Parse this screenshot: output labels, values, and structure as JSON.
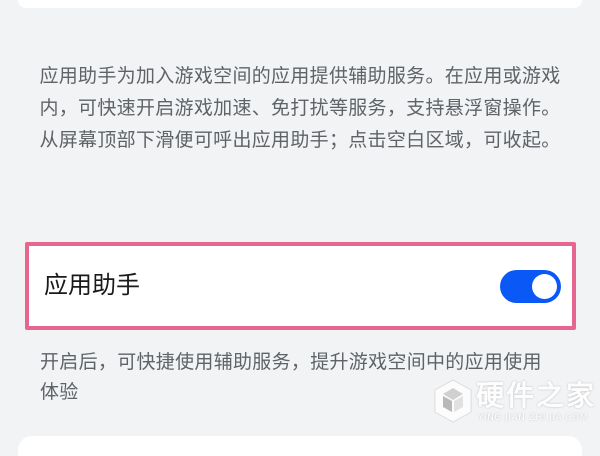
{
  "assistant_section": {
    "description": "应用助手为加入游戏空间的应用提供辅助服务。在应用或游戏内，可快速开启游戏加速、免打扰等服务，支持悬浮窗操作。从屏幕顶部下滑便可呼出应用助手；点击空白区域，可收起。",
    "setting": {
      "label": "应用助手",
      "enabled": true
    },
    "footnote": "开启后，可快捷使用辅助服务，提升游戏空间中的应用使用体验"
  },
  "watermark": {
    "brand": "硬件之家",
    "subtitle": "YING JIAN ZHI JIA.COM",
    "icon": "cube-logo-icon"
  },
  "colors": {
    "accent": "#0a59f7",
    "highlight_border": "#e66690",
    "background": "#f1f3f5",
    "card": "#ffffff",
    "secondary_text": "#5f6368"
  }
}
